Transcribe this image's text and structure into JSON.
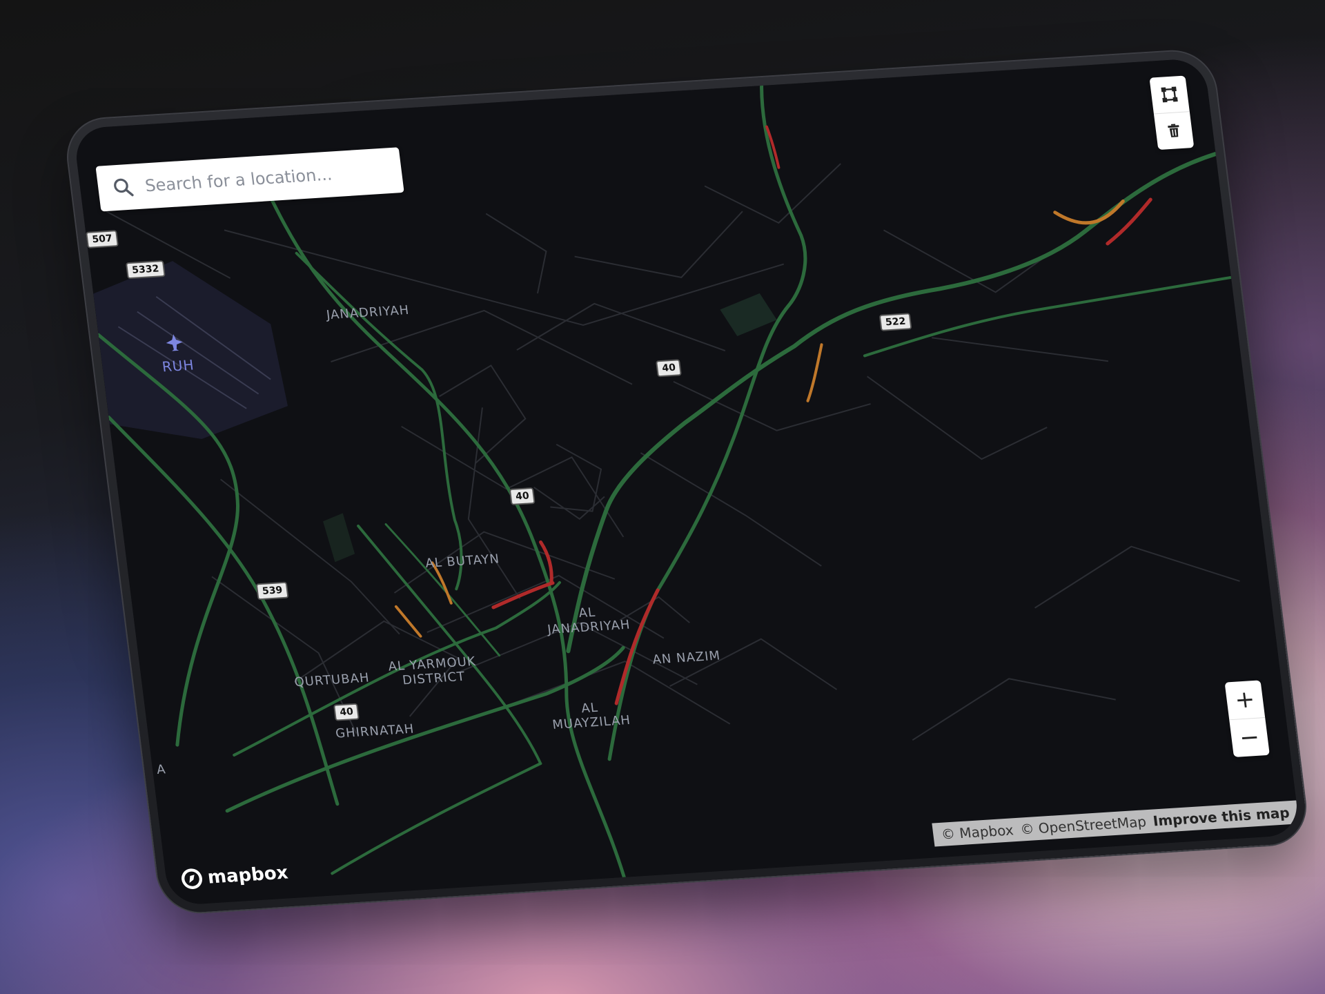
{
  "search": {
    "placeholder": "Search for a location..."
  },
  "draw_tools": {
    "polygon_icon": "polygon-draw-icon",
    "trash_icon": "trash-icon"
  },
  "zoom": {
    "zoom_in_label": "+",
    "zoom_out_label": "−"
  },
  "attribution": {
    "mapbox": "© Mapbox",
    "osm": "© OpenStreetMap",
    "improve": "Improve this map"
  },
  "logo": {
    "text": "mapbox"
  },
  "labels": {
    "janadriyah": "JANADRIYAH",
    "ruh": "RUH",
    "al_butayn": "AL BUTAYN",
    "al_janadriyah_1": "AL",
    "al_janadriyah_2": "JANADRIYAH",
    "an_nazim": "AN NAZIM",
    "qurtubah": "QURTUBAH",
    "al_yarmouk_1": "AL YARMOUK",
    "al_yarmouk_2": "DISTRICT",
    "ghirnatah": "GHIRNATAH",
    "al_muaysilah_1": "AL",
    "al_muaysilah_2": "MUAYZILAH",
    "edge_a": "A"
  },
  "shields": {
    "r507": "507",
    "r5332": "5332",
    "r40_a": "40",
    "r40_b": "40",
    "r40_c": "40",
    "r522": "522",
    "r539": "539"
  },
  "colors": {
    "map_background": "#0f1014",
    "traffic_free": "#2c6a3c",
    "traffic_moderate": "#c0782a",
    "traffic_heavy": "#b02a2a",
    "minor_road": "#2b2d33",
    "airport_area": "#1b1c2c",
    "park": "#1a2a24"
  }
}
